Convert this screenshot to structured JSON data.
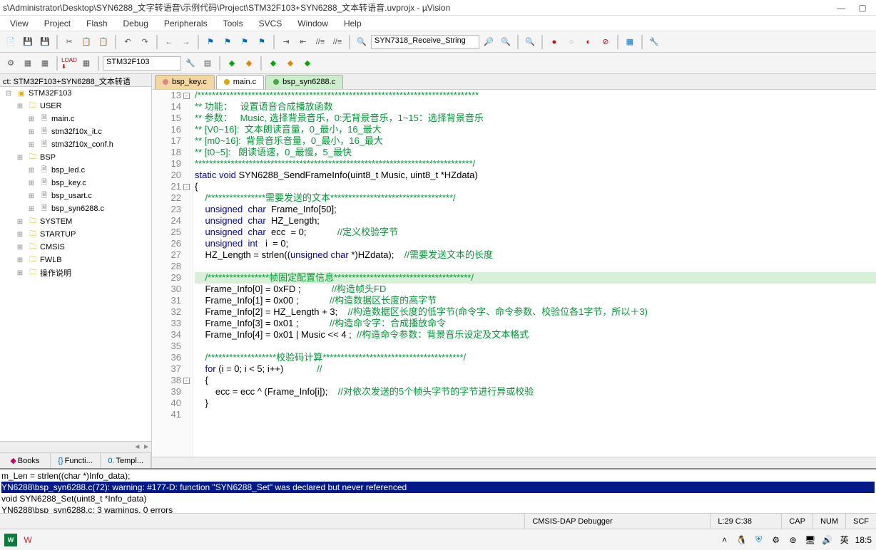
{
  "title": "s\\Administrator\\Desktop\\SYN6288_文字转语音\\示例代码\\Project\\STM32F103+SYN6288_文本转语音.uvprojx - µVision",
  "menu": [
    "View",
    "Project",
    "Flash",
    "Debug",
    "Peripherals",
    "Tools",
    "SVCS",
    "Window",
    "Help"
  ],
  "toolbar": {
    "combo1": "SYN7318_Receive_String",
    "target": "STM32F103"
  },
  "sidebar": {
    "header": "ct: STM32F103+SYN6288_文本转语",
    "tree": [
      {
        "l": 0,
        "t": "proj",
        "txt": "STM32F103"
      },
      {
        "l": 1,
        "t": "fold",
        "txt": "USER"
      },
      {
        "l": 2,
        "t": "file",
        "txt": "main.c"
      },
      {
        "l": 2,
        "t": "file",
        "txt": "stm32f10x_it.c"
      },
      {
        "l": 2,
        "t": "file",
        "txt": "stm32f10x_conf.h"
      },
      {
        "l": 1,
        "t": "fold",
        "txt": "BSP"
      },
      {
        "l": 2,
        "t": "file",
        "txt": "bsp_led.c"
      },
      {
        "l": 2,
        "t": "file",
        "txt": "bsp_key.c"
      },
      {
        "l": 2,
        "t": "file",
        "txt": "bsp_usart.c"
      },
      {
        "l": 2,
        "t": "file",
        "txt": "bsp_syn6288.c"
      },
      {
        "l": 1,
        "t": "fold",
        "txt": "SYSTEM"
      },
      {
        "l": 1,
        "t": "fold",
        "txt": "STARTUP"
      },
      {
        "l": 1,
        "t": "fold",
        "txt": "CMSIS"
      },
      {
        "l": 1,
        "t": "fold",
        "txt": "FWLB"
      },
      {
        "l": 1,
        "t": "fold",
        "txt": "操作说明"
      }
    ],
    "tabs": [
      "Books",
      "Functi...",
      "Templ..."
    ]
  },
  "file_tabs": [
    {
      "name": "bsp_key.c",
      "cls": "inactive"
    },
    {
      "name": "main.c",
      "cls": "inactive2"
    },
    {
      "name": "bsp_syn6288.c",
      "cls": "active"
    }
  ],
  "code": {
    "start": 13,
    "lines": [
      {
        "hl": false,
        "fold": "-",
        "html": "<span class='cm'>/******************************************************************************</span>"
      },
      {
        "hl": false,
        "html": "<span class='cm'>** 功能：   设置语音合成播放函数</span>"
      },
      {
        "hl": false,
        "html": "<span class='cm'>** 参数：   Music, 选择背景音乐，0:无背景音乐，1~15：选择背景音乐</span>"
      },
      {
        "hl": false,
        "html": "<span class='cm'>** [V0~16]:  文本朗读音量，0_最小，16_最大</span>"
      },
      {
        "hl": false,
        "html": "<span class='cm'>** [m0~16]:  背景音乐音量，0_最小，16_最大</span>"
      },
      {
        "hl": false,
        "html": "<span class='cm'>** [t0~5]:   朗读语速，0_最慢，5_最快</span>"
      },
      {
        "hl": false,
        "html": "<span class='cm'>*****************************************************************************/</span>"
      },
      {
        "hl": false,
        "html": "<span class='kw'>static</span> <span class='kw'>void</span> SYN6288_SendFrameInfo(uint8_t Music, uint8_t *HZdata)"
      },
      {
        "hl": false,
        "fold": "-",
        "html": "{"
      },
      {
        "hl": false,
        "html": "    <span class='cm'>/****************需要发送的文本**********************************/</span>"
      },
      {
        "hl": false,
        "html": "    <span class='kw'>unsigned</span>  <span class='kw'>char</span>  Frame_Info[50];"
      },
      {
        "hl": false,
        "html": "    <span class='kw'>unsigned</span>  <span class='kw'>char</span>  HZ_Length;"
      },
      {
        "hl": false,
        "html": "    <span class='kw'>unsigned</span>  <span class='kw'>char</span>  ecc  = 0;            <span class='cm'>//定义校验字节</span>"
      },
      {
        "hl": false,
        "html": "    <span class='kw'>unsigned</span>  <span class='kw'>int</span>   i  = 0;"
      },
      {
        "hl": false,
        "html": "    HZ_Length = strlen((<span class='kw'>unsigned</span> <span class='kw'>char</span> *)HZdata);    <span class='cm'>//需要发送文本的长度</span>"
      },
      {
        "hl": false,
        "html": ""
      },
      {
        "hl": true,
        "html": "    <span class='cm'>/*****************帧固定配置信息**************************************/</span>"
      },
      {
        "hl": false,
        "html": "    Frame_Info[0] = 0xFD ;            <span class='cm'>//构造帧头FD</span>"
      },
      {
        "hl": false,
        "html": "    Frame_Info[1] = 0x00 ;            <span class='cm'>//构造数据区长度的高字节</span>"
      },
      {
        "hl": false,
        "html": "    Frame_Info[2] = HZ_Length + 3;    <span class='cm'>//构造数据区长度的低字节(命令字、命令参数、校验位各1字节，所以＋3)</span>"
      },
      {
        "hl": false,
        "html": "    Frame_Info[3] = 0x01 ;            <span class='cm'>//构造命令字：合成播放命令</span>"
      },
      {
        "hl": false,
        "html": "    Frame_Info[4] = 0x01 | Music &lt;&lt; 4 ;  <span class='cm'>//构造命令参数：背景音乐设定及文本格式</span>"
      },
      {
        "hl": false,
        "html": ""
      },
      {
        "hl": false,
        "html": "    <span class='cm'>/*******************校验码计算***************************************/</span>"
      },
      {
        "hl": false,
        "html": "    <span class='kw'>for</span> (i = 0; i &lt; 5; i++)             <span class='cm'>//</span>"
      },
      {
        "hl": false,
        "fold": "-",
        "html": "    {"
      },
      {
        "hl": false,
        "html": "        ecc = ecc ^ (Frame_Info[i]);    <span class='cm'>//对依次发送的5个帧头字节的字节进行异或校验</span>"
      },
      {
        "hl": false,
        "html": "    }"
      },
      {
        "hl": false,
        "html": ""
      }
    ]
  },
  "build": [
    {
      "cls": "",
      "txt": "m_Len = strlen((char *)Info_data);"
    },
    {
      "cls": "bo-warn",
      "txt": "YN6288\\bsp_syn6288.c(72): warning:  #177-D: function \"SYN6288_Set\" was declared but never referenced"
    },
    {
      "cls": "",
      "txt": "  void SYN6288_Set(uint8_t *Info_data)"
    },
    {
      "cls": "",
      "txt": "YN6288\\bsp_syn6288.c: 3 warnings, 0 errors"
    }
  ],
  "status": {
    "debugger": "CMSIS-DAP Debugger",
    "pos": "L:29 C:38",
    "cap": "CAP",
    "num": "NUM",
    "scr": "SCF"
  },
  "tray": {
    "ime": "英",
    "time": "18:5"
  }
}
